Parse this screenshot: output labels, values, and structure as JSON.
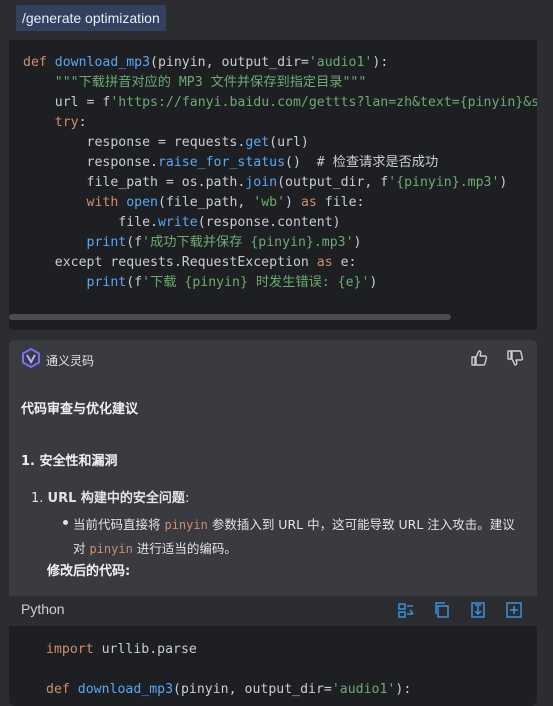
{
  "command": {
    "text": "/generate optimization"
  },
  "code_block_1": {
    "lines": [
      [
        [
          "fn_def",
          "def "
        ],
        [
          "fn",
          "download_mp3"
        ],
        [
          "plain",
          "(pinyin, output_dir="
        ],
        [
          "str",
          "'audio1'"
        ],
        [
          "plain",
          "):"
        ]
      ],
      [
        [
          "plain",
          "    "
        ],
        [
          "str",
          "\"\"\"下载拼音对应的 MP3 文件并保存到指定目录\"\"\""
        ]
      ],
      [
        [
          "plain",
          "    url = "
        ],
        [
          "plain",
          "f"
        ],
        [
          "str",
          "'https://fanyi.baidu.com/gettts?lan=zh&text={pinyin}&s"
        ]
      ],
      [
        [
          "plain",
          "    "
        ],
        [
          "kw",
          "try"
        ],
        [
          "plain",
          ":"
        ]
      ],
      [
        [
          "plain",
          "        response = requests."
        ],
        [
          "fn",
          "get"
        ],
        [
          "plain",
          "(url)"
        ]
      ],
      [
        [
          "plain",
          "        response."
        ],
        [
          "fn",
          "raise_for_status"
        ],
        [
          "plain",
          "()  # 检查请求是否成功"
        ]
      ],
      [
        [
          "plain",
          "        file_path = os.path."
        ],
        [
          "fn",
          "join"
        ],
        [
          "plain",
          "(output_dir, f"
        ],
        [
          "str",
          "'{pinyin}.mp3'"
        ],
        [
          "plain",
          ")"
        ]
      ],
      [
        [
          "plain",
          "        "
        ],
        [
          "kw",
          "with "
        ],
        [
          "fn",
          "open"
        ],
        [
          "plain",
          "(file_path, "
        ],
        [
          "str",
          "'wb'"
        ],
        [
          "plain",
          ") "
        ],
        [
          "kw",
          "as "
        ],
        [
          "plain",
          "file:"
        ]
      ],
      [
        [
          "plain",
          "            file."
        ],
        [
          "fn",
          "write"
        ],
        [
          "plain",
          "(response.content)"
        ]
      ],
      [
        [
          "plain",
          "        "
        ],
        [
          "fn",
          "print"
        ],
        [
          "plain",
          "(f"
        ],
        [
          "str",
          "'成功下载并保存 {pinyin}.mp3'"
        ],
        [
          "plain",
          ")"
        ]
      ],
      [
        [
          "plain",
          "    except requests.RequestException "
        ],
        [
          "kw",
          "as "
        ],
        [
          "plain",
          "e:"
        ]
      ],
      [
        [
          "plain",
          "        "
        ],
        [
          "fn",
          "print"
        ],
        [
          "plain",
          "(f"
        ],
        [
          "str",
          "'下载 {pinyin} 时发生错误: {e}'"
        ],
        [
          "plain",
          ")"
        ]
      ]
    ]
  },
  "assistant": {
    "brand": "通义灵码",
    "title": "代码审查与优化建议",
    "section": "1. 安全性和漏洞",
    "item_number": "1.",
    "item_title": "URL 构建中的安全问题",
    "item_colon": ":",
    "bullet_parts": [
      [
        "text",
        "当前代码直接将 "
      ],
      [
        "code",
        "pinyin"
      ],
      [
        "text",
        " 参数插入到 URL 中，这可能导致 URL 注入攻击。建议对 "
      ],
      [
        "code",
        "pinyin"
      ],
      [
        "text",
        " 进行适当的编码。"
      ]
    ],
    "modified_label": "修改后的代码:"
  },
  "code_block_2": {
    "language": "Python",
    "lines": [
      [
        [
          "kw",
          "import "
        ],
        [
          "plain",
          "urllib.parse"
        ]
      ],
      [
        [
          "plain",
          ""
        ]
      ],
      [
        [
          "kw",
          "def "
        ],
        [
          "fn",
          "download_mp3"
        ],
        [
          "plain",
          "(pinyin, output_dir="
        ],
        [
          "str",
          "'audio1'"
        ],
        [
          "plain",
          "):"
        ]
      ]
    ]
  },
  "colors": {
    "keyword": "#cf8e6d",
    "function": "#56a8f5",
    "string": "#6aab73",
    "accent": "#3d8fe0"
  },
  "icons": [
    "logo-icon",
    "thumbs-up-icon",
    "thumbs-down-icon",
    "diff-icon",
    "copy-icon",
    "insert-icon",
    "new-file-icon"
  ]
}
